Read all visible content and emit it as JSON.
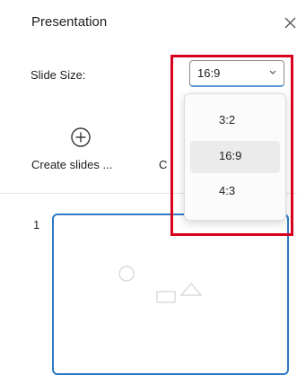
{
  "panel": {
    "title": "Presentation"
  },
  "slide_size": {
    "label": "Slide Size:",
    "selected": "16:9"
  },
  "dropdown": {
    "options": [
      {
        "label": "3:2",
        "selected": false
      },
      {
        "label": "16:9",
        "selected": true
      },
      {
        "label": "4:3",
        "selected": false
      }
    ]
  },
  "actions": {
    "create_slides_label": "Create slides ...",
    "second_action_label": "C"
  },
  "slides": [
    {
      "number": "1"
    }
  ],
  "colors": {
    "accent": "#2e78c6",
    "highlight": "#d7001f",
    "selected_option_bg": "#ebebeb"
  },
  "icons": {
    "close": "close-icon",
    "create": "plus-circle-icon",
    "caret": "chevron-down-icon"
  }
}
